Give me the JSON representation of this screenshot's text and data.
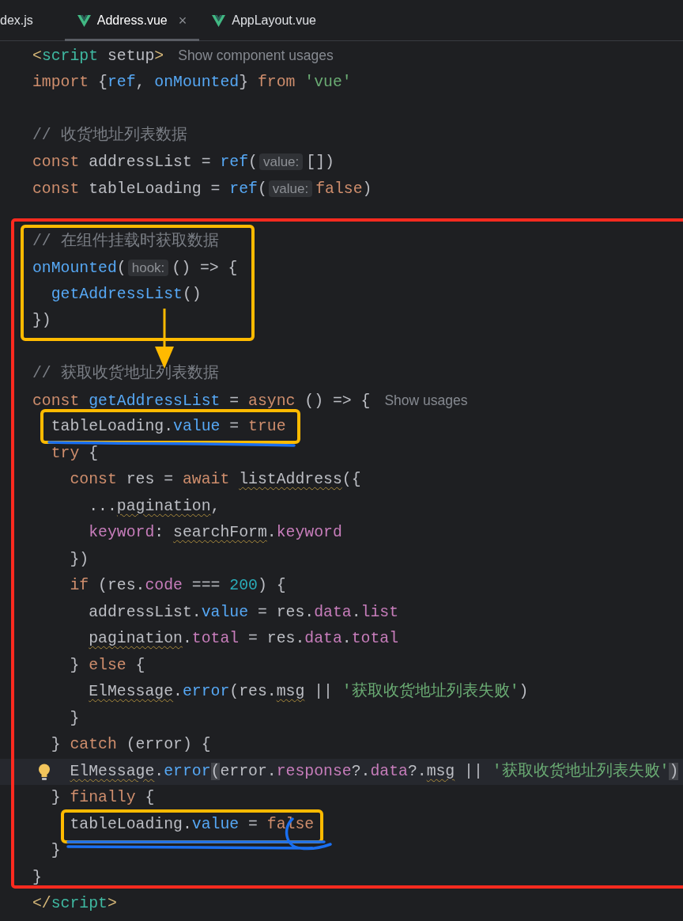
{
  "tabs": [
    {
      "label": "dex.js",
      "kind": "js",
      "selected": false
    },
    {
      "label": "Address.vue",
      "kind": "vue",
      "selected": true,
      "close": "×"
    },
    {
      "label": "AppLayout.vue",
      "kind": "vue",
      "selected": false
    }
  ],
  "code_lines": [
    {
      "tokens": [
        {
          "kind": "bracket",
          "text": "<"
        },
        {
          "kind": "tagname",
          "text": "script"
        },
        {
          "kind": "plain",
          "text": " setup"
        },
        {
          "kind": "bracket",
          "text": ">"
        },
        {
          "kind": "codevision",
          "text": "Show component usages"
        }
      ]
    },
    {
      "tokens": [
        {
          "kind": "kw",
          "text": "import "
        },
        {
          "kind": "plain",
          "text": "{"
        },
        {
          "kind": "fn",
          "text": "ref"
        },
        {
          "kind": "plain",
          "text": ", "
        },
        {
          "kind": "fn",
          "text": "onMounted"
        },
        {
          "kind": "plain",
          "text": "} "
        },
        {
          "kind": "kw",
          "text": "from "
        },
        {
          "kind": "str",
          "text": "'vue'"
        }
      ]
    },
    {
      "gap_before": true,
      "tokens": [
        {
          "kind": "cmt",
          "text": "// 收货地址列表数据"
        }
      ]
    },
    {
      "tokens": [
        {
          "kind": "kw",
          "text": "const "
        },
        {
          "kind": "plain",
          "text": "addressList = "
        },
        {
          "kind": "fn",
          "text": "ref"
        },
        {
          "kind": "plain",
          "text": "("
        },
        {
          "kind": "inlay",
          "text": "value:"
        },
        {
          "kind": "plain",
          "text": "[])"
        }
      ]
    },
    {
      "tokens": [
        {
          "kind": "kw",
          "text": "const "
        },
        {
          "kind": "plain",
          "text": "tableLoading = "
        },
        {
          "kind": "fn",
          "text": "ref"
        },
        {
          "kind": "plain",
          "text": "("
        },
        {
          "kind": "inlay",
          "text": "value:"
        },
        {
          "kind": "kw",
          "text": "false"
        },
        {
          "kind": "plain",
          "text": ")"
        }
      ]
    },
    {
      "gap_before": true,
      "tokens": [
        {
          "kind": "cmt",
          "text": "// 在组件挂载时获取数据"
        }
      ]
    },
    {
      "tokens": [
        {
          "kind": "fn",
          "text": "onMounted"
        },
        {
          "kind": "plain",
          "text": "("
        },
        {
          "kind": "inlay",
          "text": "hook:"
        },
        {
          "kind": "plain",
          "text": "() => {"
        }
      ]
    },
    {
      "tokens": [
        {
          "kind": "fn",
          "text": "  getAddressList"
        },
        {
          "kind": "plain",
          "text": "()"
        }
      ]
    },
    {
      "tokens": [
        {
          "kind": "plain",
          "text": "})"
        }
      ]
    },
    {
      "gap_before": true,
      "tokens": [
        {
          "kind": "cmt",
          "text": "// 获取收货地址列表数据"
        }
      ]
    },
    {
      "tokens": [
        {
          "kind": "kw",
          "text": "const "
        },
        {
          "kind": "fn",
          "text": "getAddressList"
        },
        {
          "kind": "plain",
          "text": " = "
        },
        {
          "kind": "kw",
          "text": "async "
        },
        {
          "kind": "plain",
          "text": "() => {"
        },
        {
          "kind": "codevision",
          "text": "Show usages"
        }
      ]
    },
    {
      "tokens": [
        {
          "kind": "plain",
          "text": "  tableLoading."
        },
        {
          "kind": "fn",
          "text": "value"
        },
        {
          "kind": "plain",
          "text": " = "
        },
        {
          "kind": "kw",
          "text": "true"
        }
      ]
    },
    {
      "tokens": [
        {
          "kind": "kw",
          "text": "  try "
        },
        {
          "kind": "plain",
          "text": "{"
        }
      ]
    },
    {
      "tokens": [
        {
          "kind": "kw",
          "text": "    const "
        },
        {
          "kind": "plain",
          "text": "res = "
        },
        {
          "kind": "kw",
          "text": "await "
        },
        {
          "kind": "plain",
          "text": "listAddress",
          "squiggle": true
        },
        {
          "kind": "plain",
          "text": "({"
        }
      ]
    },
    {
      "tokens": [
        {
          "kind": "plain",
          "text": "      ..."
        },
        {
          "kind": "plain",
          "text": "pagination",
          "squiggle": true
        },
        {
          "kind": "plain",
          "text": ","
        }
      ]
    },
    {
      "tokens": [
        {
          "kind": "prop",
          "text": "      keyword"
        },
        {
          "kind": "plain",
          "text": ": "
        },
        {
          "kind": "plain",
          "text": "searchForm",
          "squiggle": true
        },
        {
          "kind": "plain",
          "text": "."
        },
        {
          "kind": "prop",
          "text": "keyword"
        }
      ]
    },
    {
      "tokens": [
        {
          "kind": "plain",
          "text": "    })"
        }
      ]
    },
    {
      "tokens": [
        {
          "kind": "kw",
          "text": "    if "
        },
        {
          "kind": "plain",
          "text": "(res."
        },
        {
          "kind": "prop",
          "text": "code"
        },
        {
          "kind": "plain",
          "text": " === "
        },
        {
          "kind": "num",
          "text": "200"
        },
        {
          "kind": "plain",
          "text": ") {"
        }
      ]
    },
    {
      "tokens": [
        {
          "kind": "plain",
          "text": "      addressList."
        },
        {
          "kind": "fn",
          "text": "value"
        },
        {
          "kind": "plain",
          "text": " = res."
        },
        {
          "kind": "prop",
          "text": "data"
        },
        {
          "kind": "plain",
          "text": "."
        },
        {
          "kind": "prop",
          "text": "list"
        }
      ]
    },
    {
      "tokens": [
        {
          "kind": "plain",
          "text": "      pagination",
          "squiggle": true
        },
        {
          "kind": "plain",
          "text": "."
        },
        {
          "kind": "prop",
          "text": "total"
        },
        {
          "kind": "plain",
          "text": " = res."
        },
        {
          "kind": "prop",
          "text": "data"
        },
        {
          "kind": "plain",
          "text": "."
        },
        {
          "kind": "prop",
          "text": "total"
        }
      ]
    },
    {
      "tokens": [
        {
          "kind": "plain",
          "text": "    } "
        },
        {
          "kind": "kw",
          "text": "else "
        },
        {
          "kind": "plain",
          "text": "{"
        }
      ]
    },
    {
      "tokens": [
        {
          "kind": "plain",
          "text": "      ElMessage",
          "squiggle": true
        },
        {
          "kind": "plain",
          "text": "."
        },
        {
          "kind": "fn",
          "text": "error"
        },
        {
          "kind": "plain",
          "text": "(res."
        },
        {
          "kind": "plain",
          "text": "msg",
          "squiggle": true
        },
        {
          "kind": "plain",
          "text": " || "
        },
        {
          "kind": "str",
          "text": "'获取收货地址列表失败'"
        },
        {
          "kind": "plain",
          "text": ")"
        }
      ]
    },
    {
      "tokens": [
        {
          "kind": "plain",
          "text": "    }"
        }
      ]
    },
    {
      "tokens": [
        {
          "kind": "plain",
          "text": "  } "
        },
        {
          "kind": "kw",
          "text": "catch "
        },
        {
          "kind": "plain",
          "text": "(error) {"
        }
      ]
    },
    {
      "current": true,
      "bulb": true,
      "tokens": [
        {
          "kind": "plain",
          "text": "    ElMessage",
          "squiggle": true
        },
        {
          "kind": "plain",
          "text": "."
        },
        {
          "kind": "fn",
          "text": "error"
        },
        {
          "kind": "match",
          "text": "("
        },
        {
          "kind": "plain",
          "text": "error."
        },
        {
          "kind": "prop",
          "text": "response"
        },
        {
          "kind": "plain",
          "text": "?."
        },
        {
          "kind": "prop",
          "text": "data"
        },
        {
          "kind": "plain",
          "text": "?."
        },
        {
          "kind": "plain",
          "text": "msg",
          "squiggle": true
        },
        {
          "kind": "plain",
          "text": " || "
        },
        {
          "kind": "str",
          "text": "'获取收货地址列表失败'"
        },
        {
          "kind": "match",
          "text": ")"
        }
      ]
    },
    {
      "tokens": [
        {
          "kind": "plain",
          "text": "  } "
        },
        {
          "kind": "kw",
          "text": "finally "
        },
        {
          "kind": "plain",
          "text": "{"
        }
      ]
    },
    {
      "tokens": [
        {
          "kind": "plain",
          "text": "    tableLoading."
        },
        {
          "kind": "fn",
          "text": "value"
        },
        {
          "kind": "plain",
          "text": " = "
        },
        {
          "kind": "kw",
          "text": "false"
        }
      ]
    },
    {
      "tokens": [
        {
          "kind": "plain",
          "text": "  }"
        }
      ]
    },
    {
      "tokens": [
        {
          "kind": "plain",
          "text": "}"
        }
      ]
    },
    {
      "tokens": [
        {
          "kind": "bracket",
          "text": "</"
        },
        {
          "kind": "tagname",
          "text": "script"
        },
        {
          "kind": "bracket",
          "text": ">"
        }
      ]
    }
  ]
}
